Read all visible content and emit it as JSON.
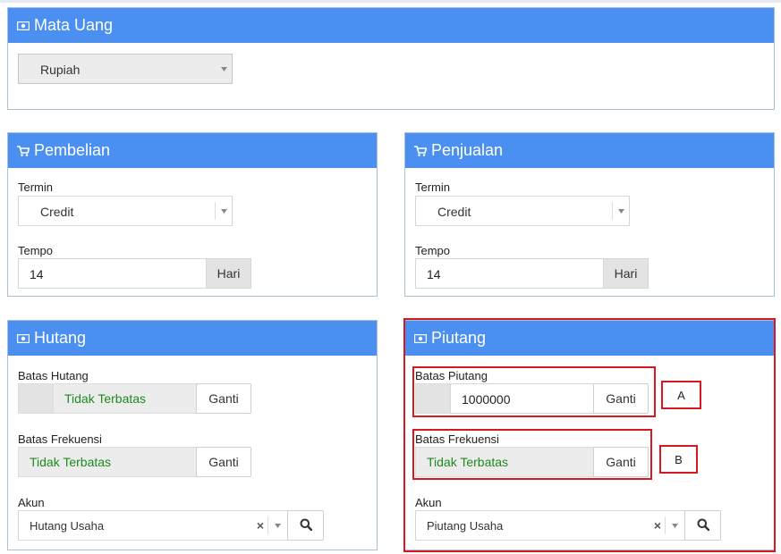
{
  "colors": {
    "header_bg": "#4b8ff0",
    "annotation_red": "#d7191f",
    "status_green": "#1f8a1f"
  },
  "mata_uang": {
    "title": "Mata Uang",
    "icon": "money-icon",
    "currency_value": "Rupiah"
  },
  "pembelian": {
    "title": "Pembelian",
    "icon": "cart-icon",
    "termin_label": "Termin",
    "termin_value": "Credit",
    "tempo_label": "Tempo",
    "tempo_value": "14",
    "tempo_unit": "Hari"
  },
  "penjualan": {
    "title": "Penjualan",
    "icon": "cart-icon",
    "termin_label": "Termin",
    "termin_value": "Credit",
    "tempo_label": "Tempo",
    "tempo_value": "14",
    "tempo_unit": "Hari"
  },
  "hutang": {
    "title": "Hutang",
    "icon": "money-icon",
    "batas_label": "Batas Hutang",
    "batas_value": "Tidak Terbatas",
    "batas_button": "Ganti",
    "frekuensi_label": "Batas Frekuensi",
    "frekuensi_value": "Tidak Terbatas",
    "frekuensi_button": "Ganti",
    "akun_label": "Akun",
    "akun_value": "Hutang Usaha",
    "clear_symbol": "×"
  },
  "piutang": {
    "title": "Piutang",
    "icon": "money-icon",
    "batas_label": "Batas Piutang",
    "batas_value": "1000000",
    "batas_button": "Ganti",
    "frekuensi_label": "Batas Frekuensi",
    "frekuensi_value": "Tidak Terbatas",
    "frekuensi_button": "Ganti",
    "akun_label": "Akun",
    "akun_value": "Piutang Usaha",
    "clear_symbol": "×"
  },
  "annotations": {
    "a": "A",
    "b": "B"
  }
}
